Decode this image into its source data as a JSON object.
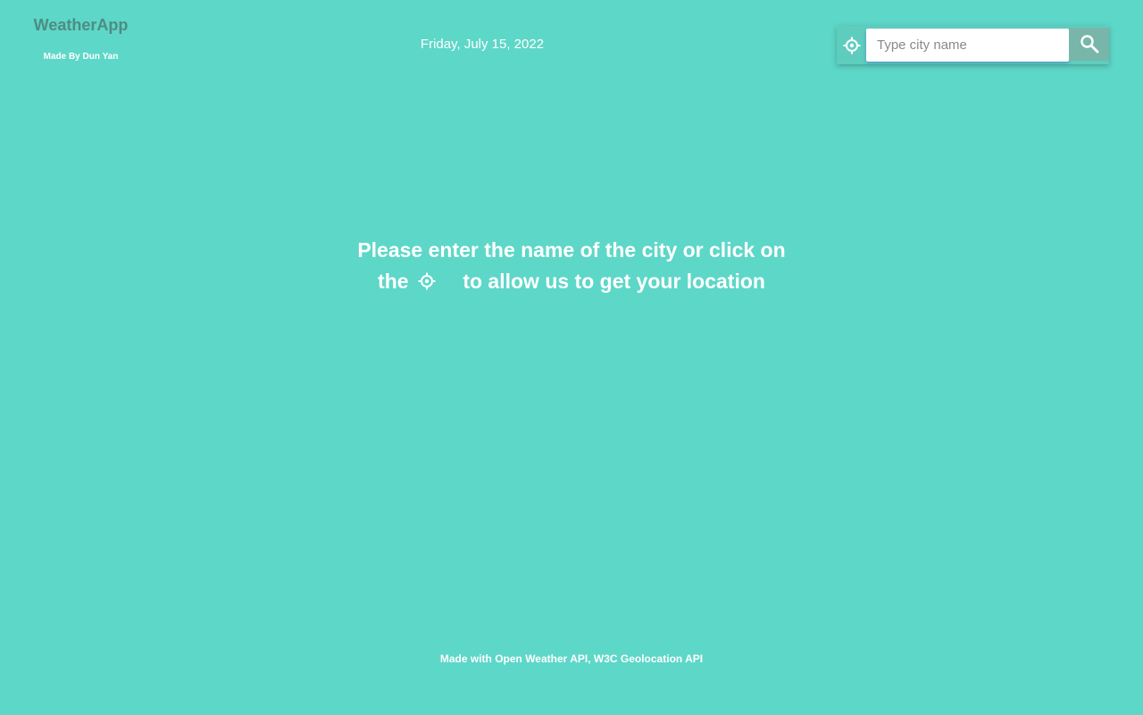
{
  "brand": {
    "title": "WeatherApp",
    "subtitle": "Made By Dun Yan"
  },
  "header": {
    "date": "Friday, July 15, 2022"
  },
  "search": {
    "placeholder": "Type city name",
    "value": "",
    "locate_icon": "crosshair-location-icon",
    "search_icon": "magnifier-icon"
  },
  "main": {
    "message_line1": "Please enter the name of the city or click on",
    "message_line2_before": "the",
    "message_line2_after": "to allow us to get your location",
    "inline_icon": "crosshair-location-icon"
  },
  "footer": {
    "text": "Made with Open Weather API, W3C Geolocation API"
  },
  "colors": {
    "background": "#5dd7c8",
    "brand_title": "#4f8c82",
    "search_button": "#78b6a9",
    "text": "#ffffff"
  }
}
